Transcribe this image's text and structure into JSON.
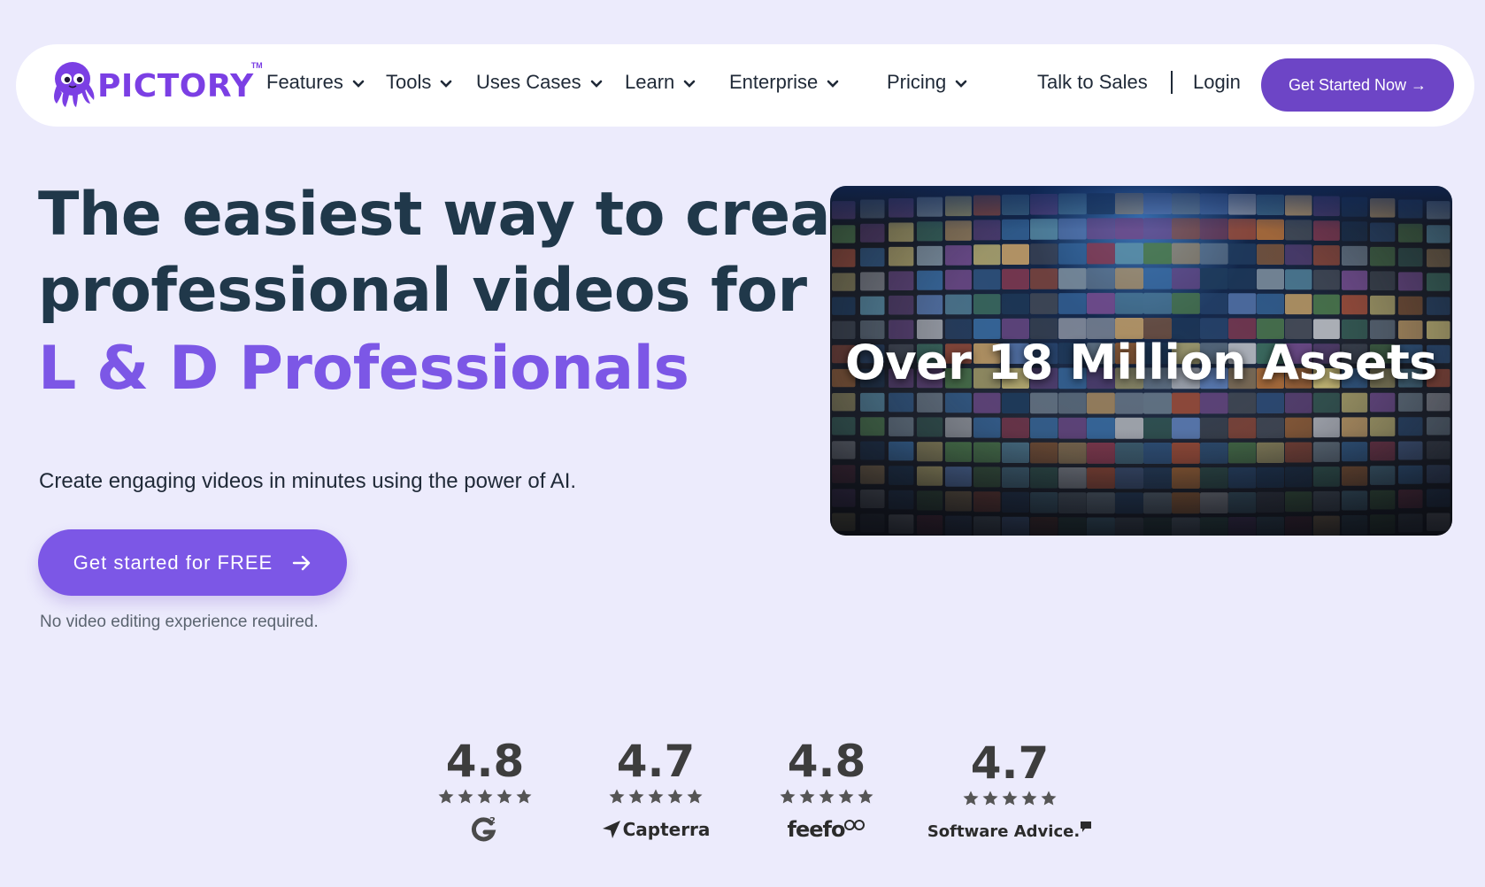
{
  "brand": {
    "name": "PICTORY",
    "tm": "TM",
    "color": "#7b3fe4"
  },
  "nav": {
    "items": [
      {
        "label": "Features",
        "has_dropdown": true
      },
      {
        "label": "Tools",
        "has_dropdown": true
      },
      {
        "label": "Uses Cases",
        "has_dropdown": true
      },
      {
        "label": "Learn",
        "has_dropdown": true
      },
      {
        "label": "Enterprise",
        "has_dropdown": true
      },
      {
        "label": "Pricing",
        "has_dropdown": true
      }
    ],
    "talk_to_sales": "Talk to Sales",
    "login": "Login",
    "cta": "Get Started Now →",
    "cta_color": "#6d45c6"
  },
  "hero": {
    "title_line1": "The easiest way to create",
    "title_line2": "professional videos for",
    "title_accent": "L & D Professionals",
    "accent_color": "#7c57e6",
    "subtitle": "Create engaging videos in minutes using the power of AI.",
    "cta": "Get started for FREE",
    "note": "No video editing experience required."
  },
  "media": {
    "caption": "Over 18 Million Assets"
  },
  "ratings": [
    {
      "value": "4.8",
      "stars": 5,
      "source_icon": "g2-logo-icon"
    },
    {
      "value": "4.7",
      "stars": 5,
      "source": "Capterra",
      "source_icon": "capterra-logo-icon"
    },
    {
      "value": "4.8",
      "stars": 5,
      "source": "feefo",
      "source_icon": "feefo-logo-icon"
    },
    {
      "value": "4.7",
      "stars": 5,
      "source": "Software Advice.",
      "source_icon": "software-advice-logo-icon"
    }
  ]
}
